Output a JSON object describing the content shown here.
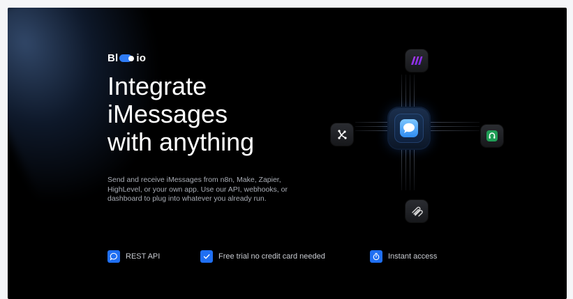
{
  "brand": {
    "logo_left": "Bl",
    "logo_right": "io"
  },
  "hero": {
    "headline_lines": [
      "Integrate",
      "iMessages",
      "with anything"
    ],
    "description": "Send and receive iMessages from n8n, Make, Zapier, HighLevel, or your own app. Use our API, webhooks, or dashboard to plug into whatever you already run."
  },
  "features": [
    {
      "label": "REST API",
      "icon": "chat-bubble-icon"
    },
    {
      "label": "Free trial no credit card needed",
      "icon": "checkmark-icon"
    },
    {
      "label": "Instant access",
      "icon": "stopwatch-icon"
    }
  ],
  "integrations": {
    "center": "imessage-icon",
    "top": "make-icon",
    "left": "n8n-icon",
    "right": "highlevel-icon",
    "bottom": "zapier-icon"
  },
  "colors": {
    "accent": "#1f6ff2",
    "background": "#000000",
    "page": "#f5f6f8"
  }
}
